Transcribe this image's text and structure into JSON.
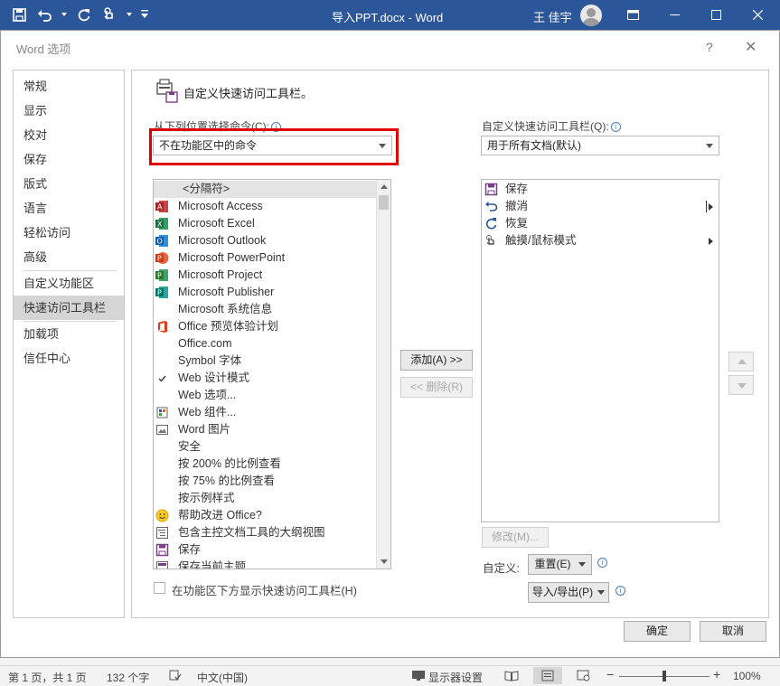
{
  "window": {
    "title": "导入PPT.docx  -  Word",
    "user": "王 佳宇"
  },
  "dialog": {
    "title": "Word 选项",
    "help": "?",
    "close": "✕",
    "nav": [
      "常规",
      "显示",
      "校对",
      "保存",
      "版式",
      "语言",
      "轻松访问",
      "高级",
      "自定义功能区",
      "快速访问工具栏",
      "加载项",
      "信任中心"
    ],
    "active_nav": "快速访问工具栏",
    "heading": "自定义快速访问工具栏。",
    "choose_label": "从下列位置选择命令(C):",
    "choose_value": "不在功能区中的命令",
    "customize_label": "自定义快速访问工具栏(Q):",
    "customize_value": "用于所有文档(默认)",
    "commands": [
      {
        "label": "<分隔符>",
        "icon": "none"
      },
      {
        "label": "Microsoft Access",
        "icon": "access-icon"
      },
      {
        "label": "Microsoft Excel",
        "icon": "excel-icon"
      },
      {
        "label": "Microsoft Outlook",
        "icon": "outlook-icon"
      },
      {
        "label": "Microsoft PowerPoint",
        "icon": "powerpoint-icon"
      },
      {
        "label": "Microsoft Project",
        "icon": "project-icon"
      },
      {
        "label": "Microsoft Publisher",
        "icon": "publisher-icon"
      },
      {
        "label": "Microsoft 系统信息",
        "icon": "none"
      },
      {
        "label": "Office 预览体验计划",
        "icon": "office-icon"
      },
      {
        "label": "Office.com",
        "icon": "none"
      },
      {
        "label": "Symbol 字体",
        "icon": "none"
      },
      {
        "label": "Web 设计模式",
        "icon": "checkmark-icon"
      },
      {
        "label": "Web 选项...",
        "icon": "none"
      },
      {
        "label": "Web 组件...",
        "icon": "web-component-icon"
      },
      {
        "label": "Word 图片",
        "icon": "picture-icon"
      },
      {
        "label": "安全",
        "icon": "none"
      },
      {
        "label": "按 200% 的比例查看",
        "icon": "none"
      },
      {
        "label": "按 75% 的比例查看",
        "icon": "none"
      },
      {
        "label": "按示例样式",
        "icon": "none"
      },
      {
        "label": "帮助改进 Office?",
        "icon": "smiley-icon"
      },
      {
        "label": "包含主控文档工具的大纲视图",
        "icon": "outline-icon"
      },
      {
        "label": "保存",
        "icon": "save-icon"
      },
      {
        "label": "保存当前主题",
        "icon": "theme-icon"
      }
    ],
    "qat_items": [
      {
        "label": "保存",
        "icon": "save-icon",
        "submenu": false
      },
      {
        "label": "撤消",
        "icon": "undo-icon",
        "submenu": true
      },
      {
        "label": "恢复",
        "icon": "redo-icon",
        "submenu": false
      },
      {
        "label": "触摸/鼠标模式",
        "icon": "touch-icon",
        "submenu": true
      }
    ],
    "add_button": "添加(A) >>",
    "remove_button": "<< 删除(R)",
    "modify_button": "修改(M)...",
    "customize_text": "自定义:",
    "reset_button": "重置(E)",
    "import_export_button": "导入/导出(P)",
    "show_below_label": "在功能区下方显示快速访问工具栏(H)",
    "ok_button": "确定",
    "cancel_button": "取消"
  },
  "statusbar": {
    "page": "第 1 页，共 1 页",
    "words": "132 个字",
    "language": "中文(中国)",
    "display_settings": "显示器设置",
    "zoom_minus": "−",
    "zoom_plus": "+",
    "zoom": "100%"
  },
  "colors": {
    "word_blue": "#2b579a",
    "highlight_red": "#e00000"
  }
}
